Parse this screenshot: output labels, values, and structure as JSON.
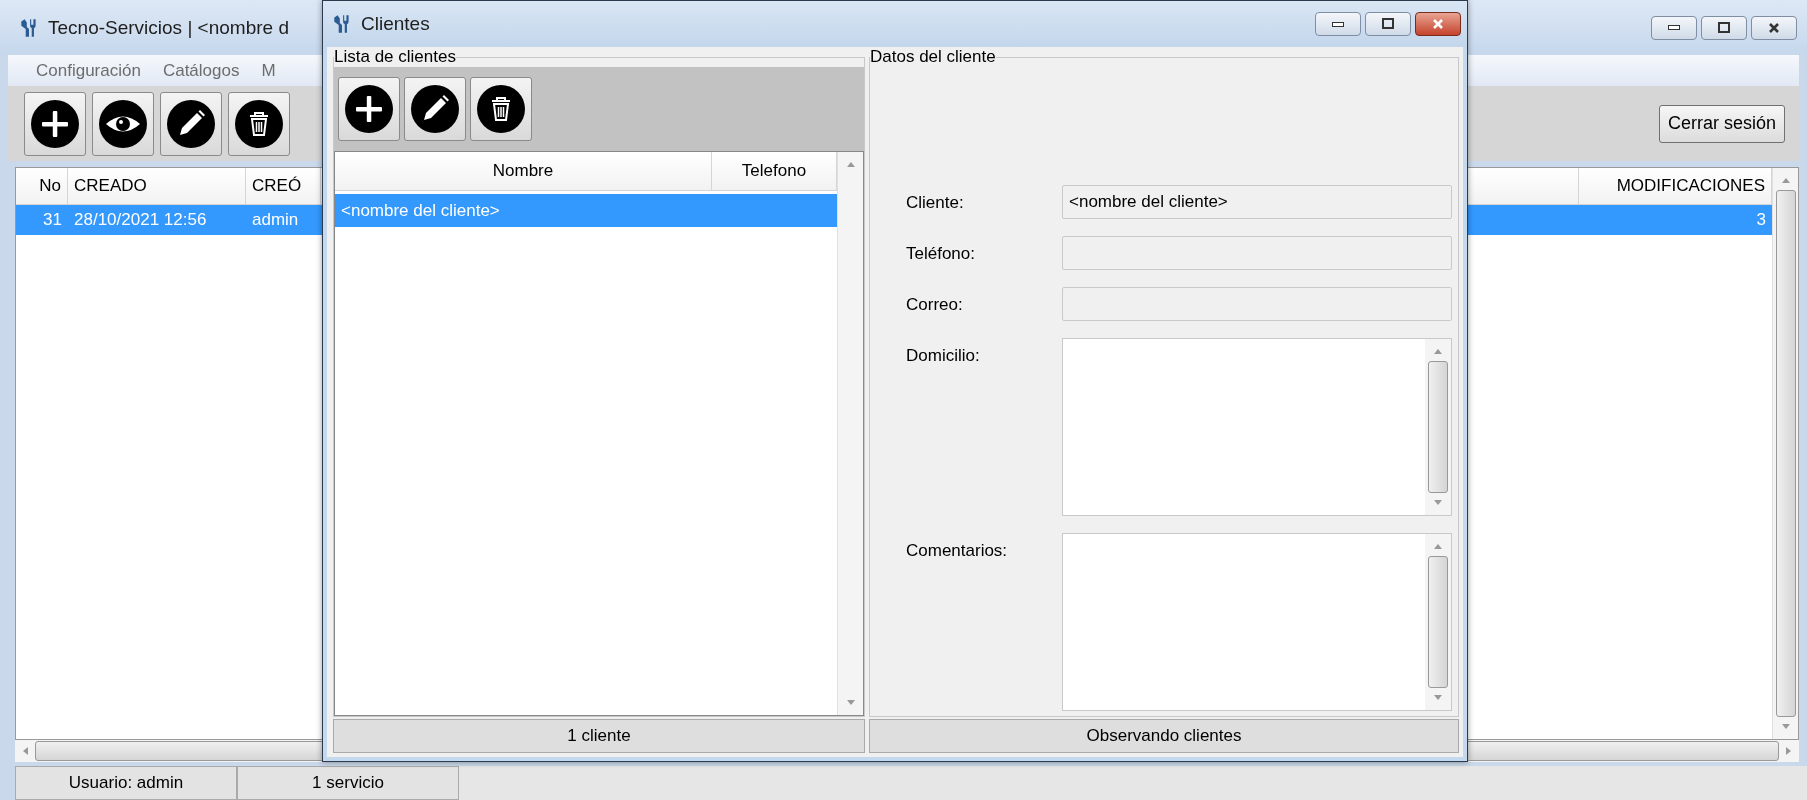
{
  "main_window": {
    "title": "Tecno-Servicios | <nombre d",
    "menu": [
      "Configuración",
      "Catálogos",
      "M"
    ],
    "toolbar": [
      {
        "kind": "add"
      },
      {
        "kind": "view"
      },
      {
        "kind": "edit"
      },
      {
        "kind": "delete"
      }
    ],
    "logout_button": "Cerrar sesión",
    "table": {
      "columns": [
        "No",
        "CREADO",
        "CREÓ",
        "MODIFICACIONES"
      ],
      "rows": [
        {
          "cells": [
            "31",
            "28/10/2021 12:56",
            "admin",
            "3"
          ],
          "selected": true
        }
      ]
    },
    "status_bar": [
      "Usuario: admin",
      "1 servicio"
    ]
  },
  "dialog": {
    "title": "Clientes",
    "client_list": {
      "title": "Lista de clientes",
      "toolbar": [
        {
          "kind": "add"
        },
        {
          "kind": "edit"
        },
        {
          "kind": "delete"
        }
      ],
      "columns": [
        "Nombre",
        "Telefono"
      ],
      "rows": [
        {
          "nombre": "<nombre del cliente>",
          "selected": true
        }
      ],
      "status": "1 cliente"
    },
    "client_data": {
      "title": "Datos del cliente",
      "fields": [
        {
          "label": "Cliente:",
          "kind": "line",
          "value": "<nombre del cliente>"
        },
        {
          "label": "Teléfono:",
          "kind": "line"
        },
        {
          "label": "Correo:",
          "kind": "line"
        },
        {
          "label": "Domicilio:",
          "kind": "area"
        },
        {
          "label": "Comentarios:",
          "kind": "area"
        }
      ],
      "status": "Observando clientes"
    }
  }
}
